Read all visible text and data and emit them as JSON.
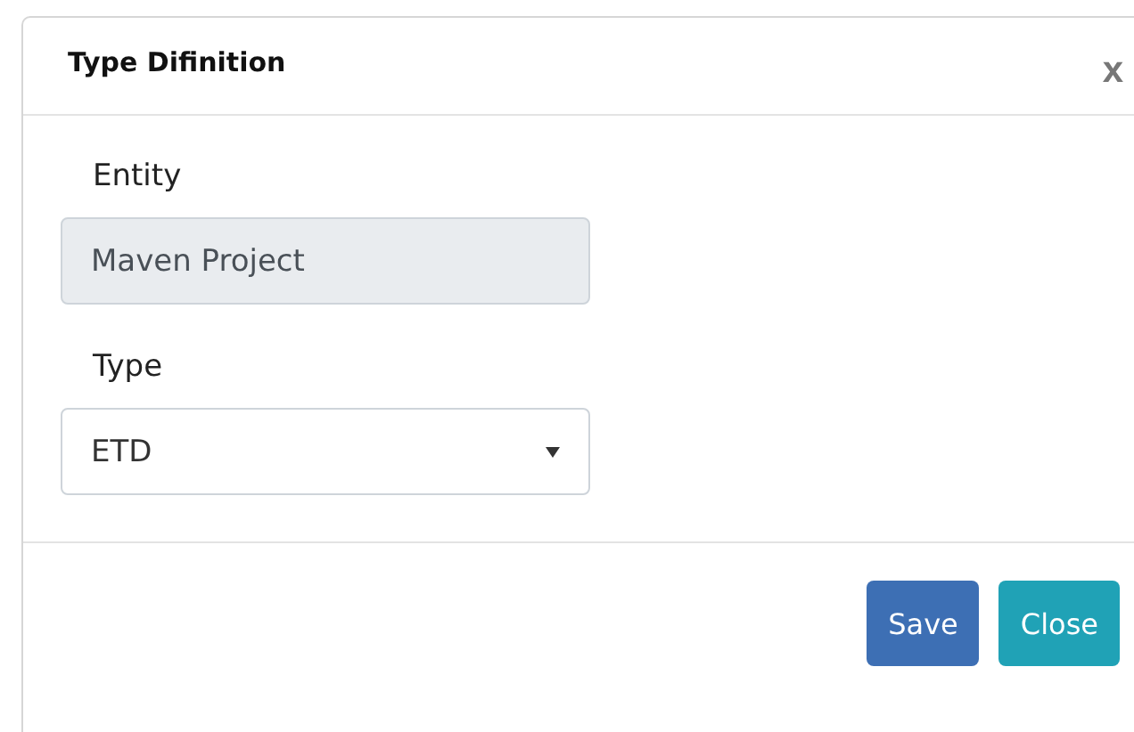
{
  "dialog": {
    "title": "Type Difinition",
    "close_glyph": "x"
  },
  "fields": [
    {
      "kind": "text",
      "label": "Entity",
      "value": "Maven Project",
      "disabled": true
    },
    {
      "kind": "select",
      "label": "Type",
      "value": "ETD",
      "disabled": false
    }
  ],
  "buttons": [
    {
      "label": "Save",
      "kind": "primary"
    },
    {
      "label": "Close",
      "kind": "info"
    }
  ]
}
